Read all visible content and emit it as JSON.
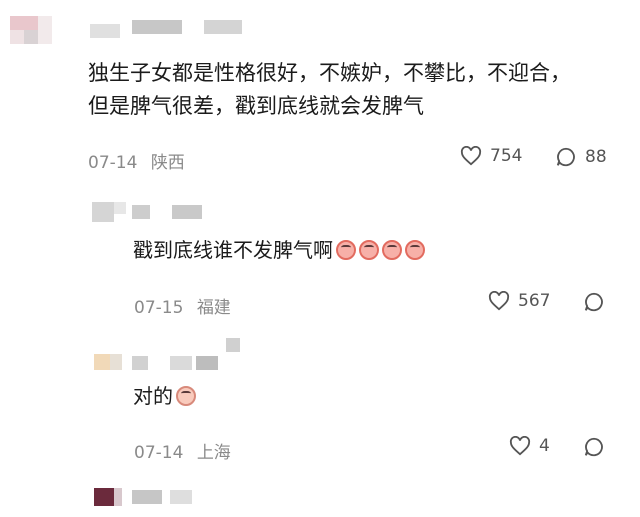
{
  "comments": [
    {
      "text_line1": "独生子女都是性格很好，不嫉妒，不攀比，不迎合，",
      "text_line2": "但是脾气很差，戳到底线就会发脾气",
      "date": "07-14",
      "location": "陕西",
      "likes": "754",
      "replies": "88"
    }
  ],
  "replies": [
    {
      "text": "戳到底线谁不发脾气啊",
      "emoji": "angry-face-icon x4",
      "date": "07-15",
      "location": "福建",
      "likes": "567"
    },
    {
      "text": "对的",
      "emoji": "surprised-face-icon",
      "date": "07-14",
      "location": "上海",
      "likes": "4"
    }
  ],
  "colors": {
    "text": "#1b1b1b",
    "meta": "#8a8a8a",
    "icon": "#555555",
    "blur": "#cfcfcf"
  }
}
